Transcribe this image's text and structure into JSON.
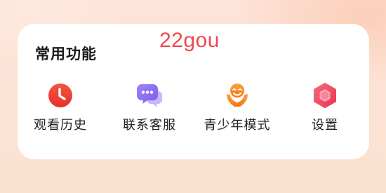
{
  "section": {
    "title": "常用功能"
  },
  "watermark": {
    "text": "22gou"
  },
  "features": [
    {
      "label": "观看历史",
      "icon": "clock-icon",
      "color": "#ee3a35"
    },
    {
      "label": "联系客服",
      "icon": "chat-bubbles-icon",
      "color": "#8b6ff2"
    },
    {
      "label": "青少年模式",
      "icon": "youth-guard-icon",
      "color": "#f5891f"
    },
    {
      "label": "设置",
      "icon": "hexagon-gear-icon",
      "color": "#f04a67"
    }
  ]
}
